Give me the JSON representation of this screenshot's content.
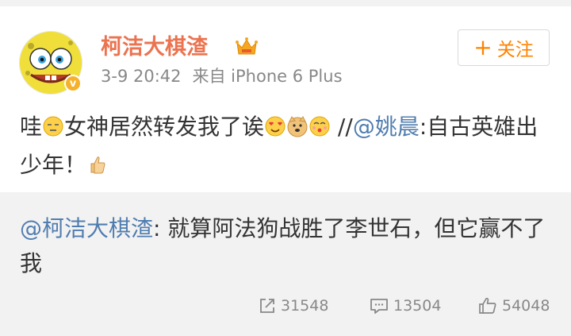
{
  "post": {
    "username": "柯洁大棋渣",
    "timestamp": "3-9 20:42",
    "source": "来自 iPhone 6 Plus",
    "follow_label": "关注",
    "content": {
      "part1": "哇",
      "part2": "女神居然转发我了诶",
      "part3": " //",
      "mention": "@姚晨",
      "part4": ":自古英雄出少年！"
    }
  },
  "repost": {
    "mention": "@柯洁大棋渣",
    "text": ": 就算阿法狗战胜了李世石，但它赢不了我"
  },
  "actions": {
    "repost_count": "31548",
    "comment_count": "13504",
    "like_count": "54048"
  },
  "icons": [
    "spongebob-avatar",
    "verified-badge-icon",
    "vip-crown-icon",
    "plus-icon",
    "emoji-shy",
    "emoji-heart-eyes",
    "emoji-doge",
    "emoji-kiss",
    "emoji-thumbs-up",
    "repost-icon",
    "comment-icon",
    "like-icon"
  ],
  "colors": {
    "username": "#eb7350",
    "mention": "#507daf",
    "follow": "#ff8200",
    "meta": "#888888"
  }
}
